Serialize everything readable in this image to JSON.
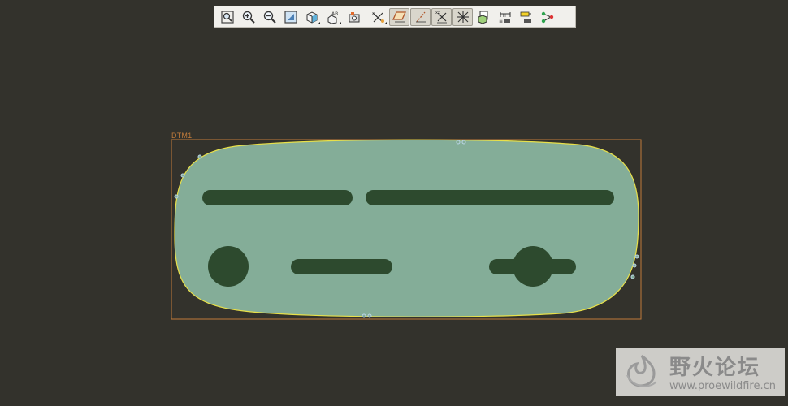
{
  "toolbar": {
    "buttons": [
      {
        "id": "zoom-window",
        "icon": "zoom-window-icon"
      },
      {
        "id": "zoom-in",
        "icon": "zoom-in-icon"
      },
      {
        "id": "zoom-out",
        "icon": "zoom-out-icon"
      },
      {
        "id": "refit",
        "icon": "refit-icon"
      },
      {
        "id": "display-style",
        "icon": "display-style-icon"
      },
      {
        "id": "saved-views",
        "icon": "saved-views-icon"
      },
      {
        "id": "annotation-display",
        "icon": "annotation-display-icon"
      },
      {
        "id": "datum-display",
        "icon": "datum-display-icon"
      },
      {
        "id": "plane-display",
        "icon": "plane-display-icon"
      },
      {
        "id": "axis-display",
        "icon": "axis-display-icon"
      },
      {
        "id": "point-display",
        "icon": "point-display-icon"
      },
      {
        "id": "csys-display",
        "icon": "csys-display-icon"
      },
      {
        "id": "sketch-orientation",
        "icon": "sketch-orientation-icon"
      },
      {
        "id": "sketcher-display",
        "icon": "sketcher-display-icon"
      },
      {
        "id": "sketch-constraints",
        "icon": "sketch-constraints-icon"
      },
      {
        "id": "sketch-vertices",
        "icon": "sketch-vertices-icon"
      }
    ]
  },
  "viewport": {
    "datum_label": "DTM1",
    "part_color": "#84ad98",
    "cutout_color": "#2d4a2e",
    "outline_color": "#e8e04a",
    "datum_color": "#c07a3a"
  },
  "watermark": {
    "title": "野火论坛",
    "url": "www.proewildfire.cn"
  }
}
